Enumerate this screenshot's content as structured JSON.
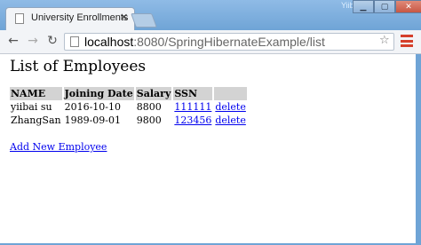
{
  "browser": {
    "tab_title": "University Enrollments",
    "watermark": "Yiibai.com",
    "url_host": "localhost",
    "url_rest": ":8080/SpringHibernateExample/list"
  },
  "page": {
    "heading": "List of Employees",
    "columns": [
      "NAME",
      "Joining Date",
      "Salary",
      "SSN",
      ""
    ],
    "rows": [
      {
        "name": "yiibai su",
        "joining_date": "2016-10-10",
        "salary": "8800",
        "ssn": "111111",
        "action": "delete"
      },
      {
        "name": "ZhangSan",
        "joining_date": "1989-09-01",
        "salary": "9800",
        "ssn": "123456",
        "action": "delete"
      }
    ],
    "add_link": "Add New Employee"
  },
  "colors": {
    "header_bg": "#d3d3d3",
    "link": "#0000ee",
    "menu_icon": "#d5402b"
  }
}
